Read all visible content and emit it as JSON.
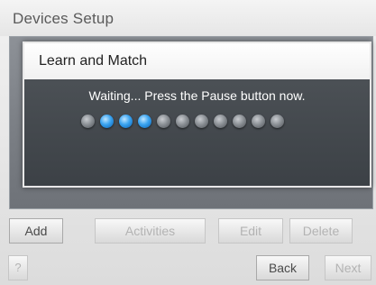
{
  "title": "Devices Setup",
  "dialog": {
    "title": "Learn and Match",
    "message": "Waiting... Press the Pause button now.",
    "progress": {
      "total_steps": 11,
      "active_steps": [
        1,
        2,
        3
      ]
    }
  },
  "actions": {
    "add": "Add",
    "activities": "Activities",
    "edit": "Edit",
    "delete": "Delete"
  },
  "nav": {
    "help": "?",
    "back": "Back",
    "next": "Next"
  },
  "colors": {
    "dot_active": "#39a3f0",
    "dot_inactive": "#8c9196"
  }
}
